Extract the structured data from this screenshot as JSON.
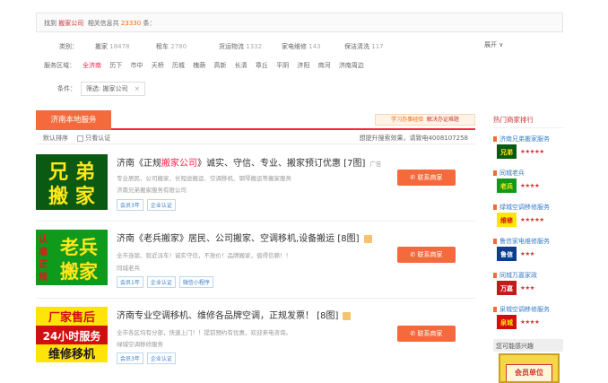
{
  "summary": {
    "prefix": "找到",
    "company": "搬家公司",
    "mid": "相关信息共",
    "count": "23330",
    "suffix": "条："
  },
  "filters": {
    "category_label": "类别：",
    "categories": [
      {
        "name": "搬家",
        "count": "18478"
      },
      {
        "name": "租车",
        "count": "2780"
      },
      {
        "name": "货运物流",
        "count": "1332"
      },
      {
        "name": "家电维修",
        "count": "143"
      },
      {
        "name": "保洁清洗",
        "count": "117"
      }
    ],
    "expand_label": "展开 ∨",
    "area_label": "服务区域：",
    "areas": [
      "全济南",
      "历下",
      "市中",
      "天桥",
      "历城",
      "槐荫",
      "高新",
      "长清",
      "章丘",
      "平阴",
      "济阳",
      "商河",
      "济南周边"
    ],
    "active_area": "全济南",
    "condition_label": "条件：",
    "condition_chip": "筛选: 搬家公司",
    "chip_close": "×"
  },
  "section": {
    "tab": "济南本地服务",
    "promo_left": "学习办事经验",
    "promo_right": "解决办证难题",
    "sort_default": "默认排序",
    "only_verified": "只看认证",
    "right_note": "想提升搜索效果，请致电4008107258"
  },
  "listings": [
    {
      "title_pre": "济南《正规",
      "title_kw": "搬家公司",
      "title_post": "》诚实、守信、专业、搬家预订优惠 [7图]",
      "tag": "广告",
      "has_vbadge": false,
      "line1": "专业居民、公司搬家、长短途搬运、空调移机、钢琴搬运等搬家服务",
      "line2": "济南兄弟搬家服务有限公司",
      "badges": [
        "会员3年",
        "企业认证"
      ],
      "contact": "联系商家",
      "thumb": {
        "lines": [
          "兄 弟",
          "搬 家"
        ],
        "bg": "#0a5a14",
        "fg": "#ffe81a"
      }
    },
    {
      "title_pre": "济南《老兵搬家》居民、公司搬家、空调移机,设备搬运 [8图]",
      "title_kw": "",
      "title_post": "",
      "tag": "",
      "has_vbadge": true,
      "line1": "全市连锁、就近派车！诚实守信，不放价！品牌搬家，值得信赖！！",
      "line2": "同城老兵",
      "badges": [
        "会员1年",
        "企业认证",
        "微信小程序"
      ],
      "contact": "联系商家",
      "thumb": {
        "lines": [
          "老兵",
          "搬家"
        ],
        "side": "认准正规",
        "bg": "#109a1c",
        "fg": "#ffe81a",
        "side_color": "#d61a1a"
      }
    },
    {
      "title_pre": "济南专业空调移机、维修各品牌空调，正规发票！ [8图]",
      "title_kw": "",
      "title_post": "",
      "tag": "",
      "has_vbadge": true,
      "line1": "全市各区均有分部，快速上门！！提前预约有优惠，欢迎来电咨询。",
      "line2": "绿城空调移修服务",
      "badges": [
        "会员3年",
        "企业认证"
      ],
      "contact": "联系商家",
      "thumb": {
        "lines": [
          "厂家售后",
          "24小时服务",
          "维修移机"
        ],
        "colors": [
          "#ffe40a",
          "#d01010",
          "#ffe40a"
        ],
        "fgs": [
          "#d01010",
          "#ffffff",
          "#1a1a1a"
        ]
      }
    }
  ],
  "sidebar": {
    "title": "热门商家排行",
    "items": [
      {
        "name": "济南兄弟搬家服务",
        "stars": "★★★★★",
        "logo_bg": "#0a5a14",
        "logo_fg": "#ffe81a",
        "logo_text": "兄弟"
      },
      {
        "name": "同城老兵",
        "stars": "★★★★",
        "logo_bg": "#109a1c",
        "logo_fg": "#ffe81a",
        "logo_text": "老兵"
      },
      {
        "name": "绿城空调移修服务",
        "stars": "★★★★★",
        "logo_bg": "#ffe40a",
        "logo_fg": "#d01010",
        "logo_text": "维修"
      },
      {
        "name": "鲁信家电维修服务",
        "stars": "★★★",
        "logo_bg": "#0b3f8c",
        "logo_fg": "#ffffff",
        "logo_text": "鲁信"
      },
      {
        "name": "同城万嘉家政",
        "stars": "★★★",
        "logo_bg": "#c41a1a",
        "logo_fg": "#ffffff",
        "logo_text": "万嘉"
      },
      {
        "name": "泉城空调移修服务",
        "stars": "★★★★",
        "logo_bg": "#d01010",
        "logo_fg": "#ffe40a",
        "logo_text": "泉城"
      }
    ],
    "section2": "您可能感兴趣",
    "bottom_ad": "会员单位"
  }
}
